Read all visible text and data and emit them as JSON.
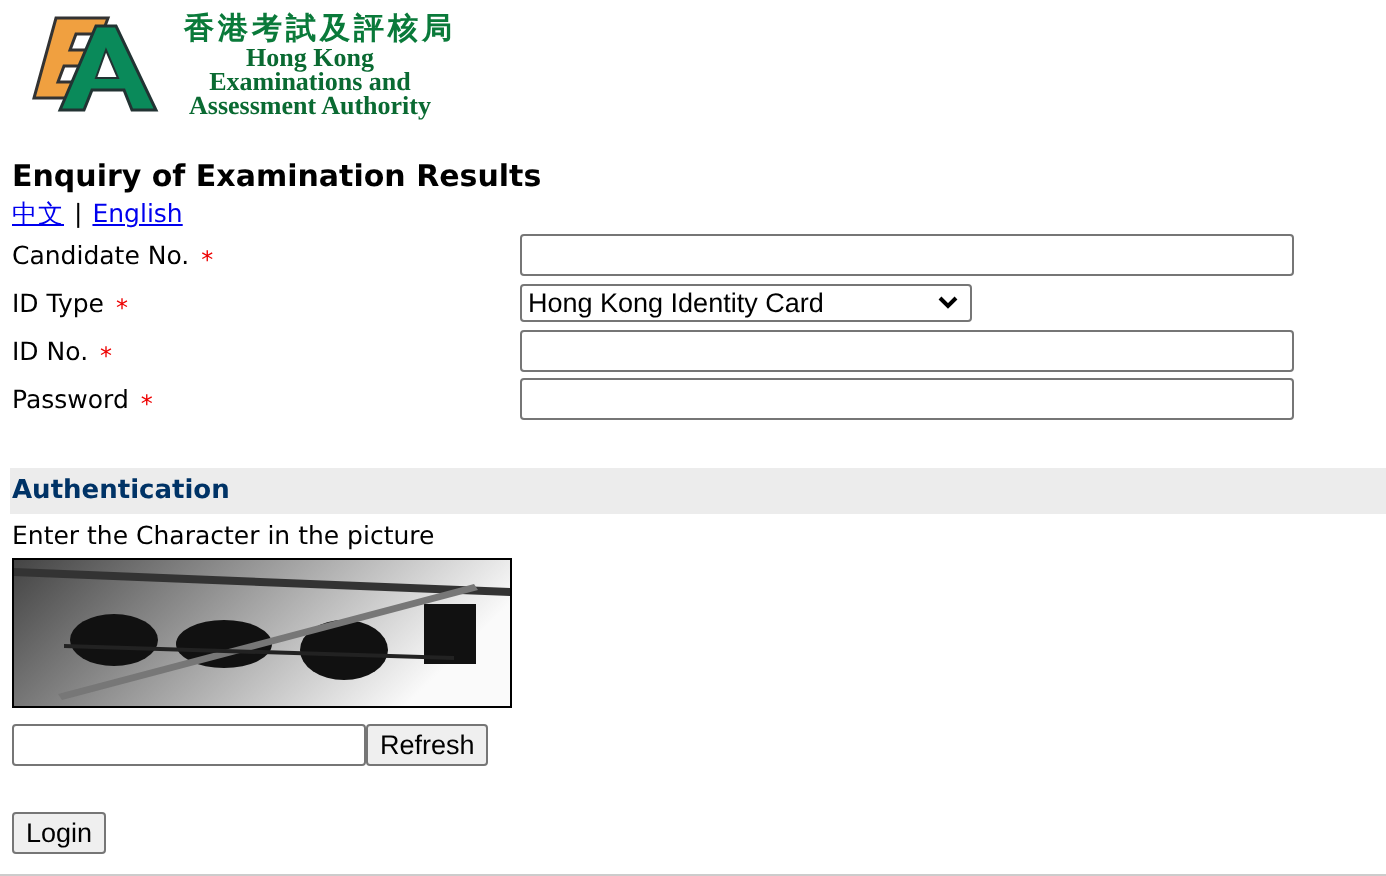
{
  "logo": {
    "chinese_name": "香港考試及評核局",
    "english_name": [
      "Hong Kong",
      "Examinations and",
      "Assessment Authority"
    ]
  },
  "title": "Enquiry of Examination Results",
  "languages": [
    "中文",
    "English"
  ],
  "language_separator": "|",
  "fields": [
    {
      "label": "Candidate No.",
      "required_mark": "*",
      "kind": "text"
    },
    {
      "label": "ID Type",
      "required_mark": "*",
      "kind": "select",
      "value": "Hong Kong Identity Card"
    },
    {
      "label": "ID No.",
      "required_mark": "*",
      "kind": "text"
    },
    {
      "label": "Password",
      "required_mark": "*",
      "kind": "text"
    }
  ],
  "authentication": {
    "heading": "Authentication",
    "instruction": "Enter the Character in the picture",
    "refresh_button": "Refresh"
  },
  "login_button": "Login"
}
